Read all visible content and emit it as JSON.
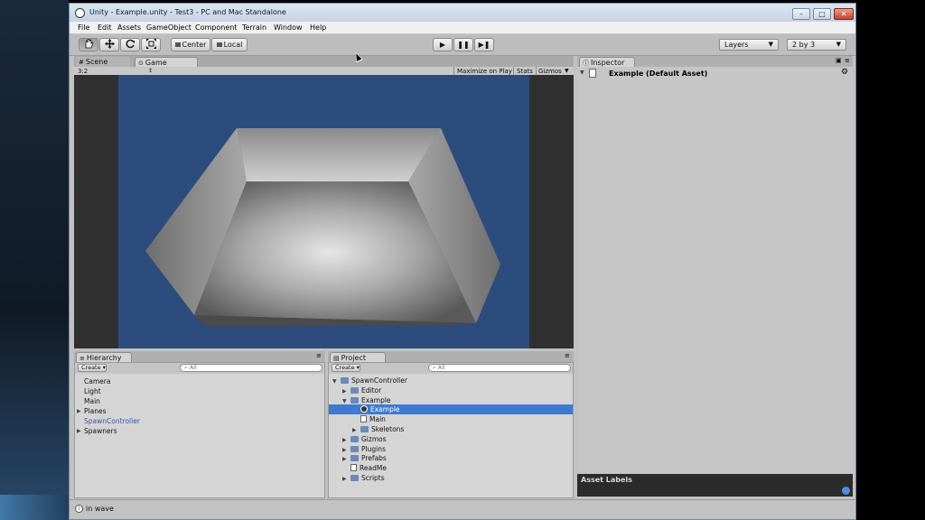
{
  "window": {
    "title": "Unity - Example.unity - Test3 - PC and Mac Standalone",
    "controls": {
      "minimize": "–",
      "maximize": "□",
      "close": "✕"
    }
  },
  "menu": [
    "File",
    "Edit",
    "Assets",
    "GameObject",
    "Component",
    "Terrain",
    "Window",
    "Help"
  ],
  "toolbar": {
    "pivot": "Center",
    "space": "Local",
    "layers": "Layers",
    "layout": "2 by 3",
    "tools": [
      "hand",
      "move",
      "rotate",
      "scale"
    ],
    "play": "▶",
    "pause": "❚❚",
    "step": "▶❚"
  },
  "views": {
    "tabs": [
      "Scene",
      "Game"
    ],
    "aspect": "3:2",
    "maximize_on_play": "Maximize on Play",
    "stats": "Stats",
    "gizmos": "Gizmos"
  },
  "inspector": {
    "tab": "Inspector",
    "asset_title": "Example (Default Asset)",
    "asset_labels": "Asset Labels"
  },
  "hierarchy": {
    "tab": "Hierarchy",
    "create": "Create",
    "search": "All",
    "items": [
      {
        "label": "Camera",
        "expandable": false,
        "highlight": false
      },
      {
        "label": "Light",
        "expandable": false,
        "highlight": false
      },
      {
        "label": "Main",
        "expandable": false,
        "highlight": false
      },
      {
        "label": "Planes",
        "expandable": true,
        "highlight": false
      },
      {
        "label": "SpawnController",
        "expandable": false,
        "highlight": true
      },
      {
        "label": "Spawners",
        "expandable": true,
        "highlight": false
      }
    ]
  },
  "project": {
    "tab": "Project",
    "create": "Create",
    "search": "All",
    "items": [
      {
        "label": "SpawnController",
        "indent": 0,
        "icon": "folder-icon",
        "state": "expanded",
        "selected": false
      },
      {
        "label": "Editor",
        "indent": 1,
        "icon": "folder-icon",
        "state": "collapsed",
        "selected": false
      },
      {
        "label": "Example",
        "indent": 1,
        "icon": "folder-icon",
        "state": "expanded",
        "selected": false
      },
      {
        "label": "Example",
        "indent": 2,
        "icon": "unity-scene-icon",
        "state": "none",
        "selected": true
      },
      {
        "label": "Main",
        "indent": 2,
        "icon": "file-icon",
        "state": "none",
        "selected": false
      },
      {
        "label": "Skeletons",
        "indent": 2,
        "icon": "folder-icon",
        "state": "collapsed",
        "selected": false
      },
      {
        "label": "Gizmos",
        "indent": 1,
        "icon": "folder-icon",
        "state": "collapsed",
        "selected": false
      },
      {
        "label": "Plugins",
        "indent": 1,
        "icon": "folder-icon",
        "state": "collapsed",
        "selected": false
      },
      {
        "label": "Prefabs",
        "indent": 1,
        "icon": "folder-icon",
        "state": "collapsed",
        "selected": false
      },
      {
        "label": "ReadMe",
        "indent": 1,
        "icon": "file-icon",
        "state": "none",
        "selected": false
      },
      {
        "label": "Scripts",
        "indent": 1,
        "icon": "folder-icon",
        "state": "collapsed",
        "selected": false
      }
    ]
  },
  "status": {
    "message": "in wave"
  }
}
